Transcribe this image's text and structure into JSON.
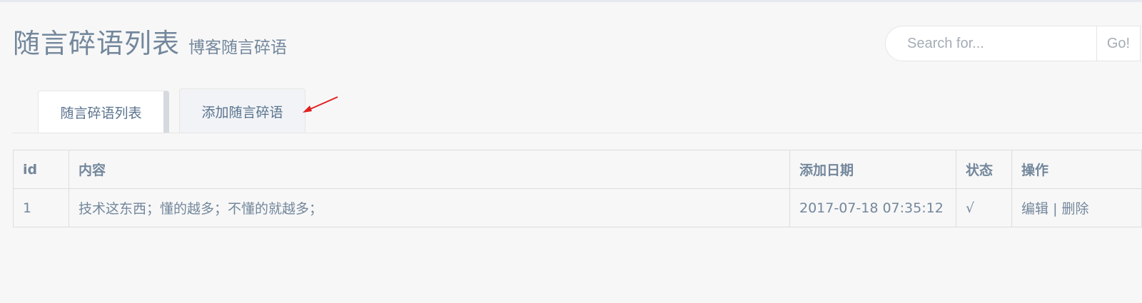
{
  "header": {
    "title": "随言碎语列表",
    "subtitle": "博客随言碎语"
  },
  "search": {
    "placeholder": "Search for...",
    "button_label": "Go!"
  },
  "tabs": [
    {
      "label": "随言碎语列表",
      "active": true
    },
    {
      "label": "添加随言碎语",
      "active": false
    }
  ],
  "annotation": {
    "arrow_color": "#e02020"
  },
  "table": {
    "columns": [
      "id",
      "内容",
      "添加日期",
      "状态",
      "操作"
    ],
    "rows": [
      {
        "id": "1",
        "content": "技术这东西；懂的越多；不懂的就越多；",
        "date": "2017-07-18 07:35:12",
        "status": "√",
        "edit": "编辑",
        "separator": "|",
        "delete": "删除"
      }
    ]
  },
  "colors": {
    "text": "#73879c",
    "background": "#f7f7f7",
    "border": "#dddddd"
  }
}
